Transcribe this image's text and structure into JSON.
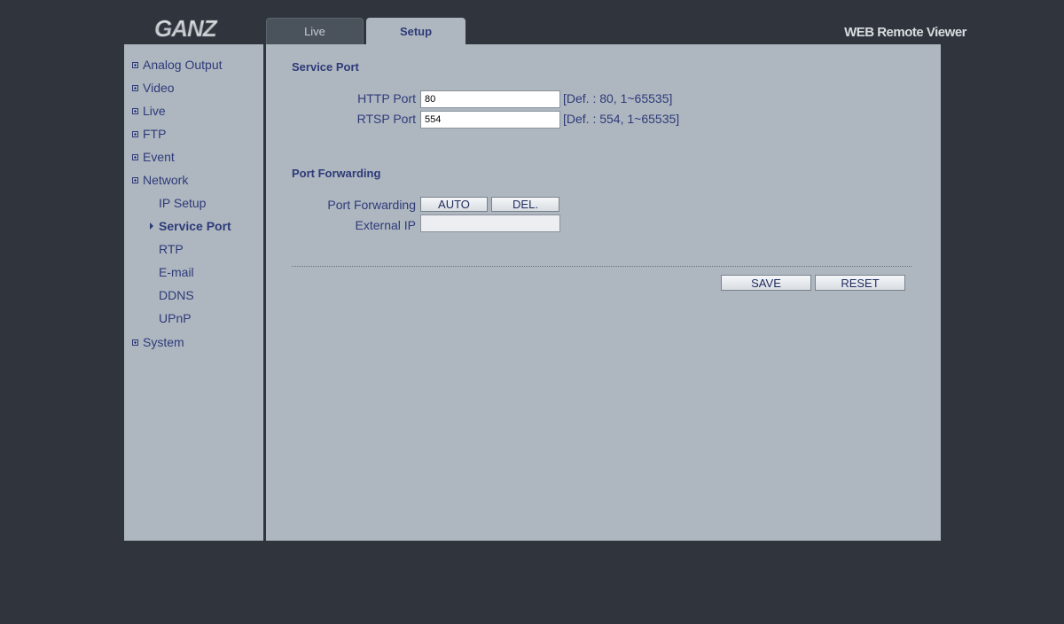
{
  "header": {
    "logo_text": "GANZ",
    "app_title": "WEB Remote Viewer",
    "tabs": [
      {
        "label": "Live",
        "active": false
      },
      {
        "label": "Setup",
        "active": true
      }
    ]
  },
  "sidebar": {
    "items": [
      {
        "label": "Analog Output"
      },
      {
        "label": "Video"
      },
      {
        "label": "Live"
      },
      {
        "label": "FTP"
      },
      {
        "label": "Event"
      },
      {
        "label": "Network"
      },
      {
        "label": "IP Setup"
      },
      {
        "label": "Service Port"
      },
      {
        "label": "RTP"
      },
      {
        "label": "E-mail"
      },
      {
        "label": "DDNS"
      },
      {
        "label": "UPnP"
      },
      {
        "label": "System"
      }
    ]
  },
  "service_port": {
    "title": "Service Port",
    "http_label": "HTTP Port",
    "http_value": "80",
    "http_hint": "[Def. : 80, 1~65535]",
    "rtsp_label": "RTSP Port",
    "rtsp_value": "554",
    "rtsp_hint": "[Def. : 554, 1~65535]"
  },
  "port_forwarding": {
    "title": "Port Forwarding",
    "pf_label": "Port Forwarding",
    "auto_label": "AUTO",
    "del_label": "DEL.",
    "external_ip_label": "External IP",
    "external_ip_value": ""
  },
  "actions": {
    "save_label": "SAVE",
    "reset_label": "RESET"
  },
  "colors": {
    "background": "#30353d",
    "panel": "#aeb7c0",
    "text_accent": "#2e3a78"
  }
}
